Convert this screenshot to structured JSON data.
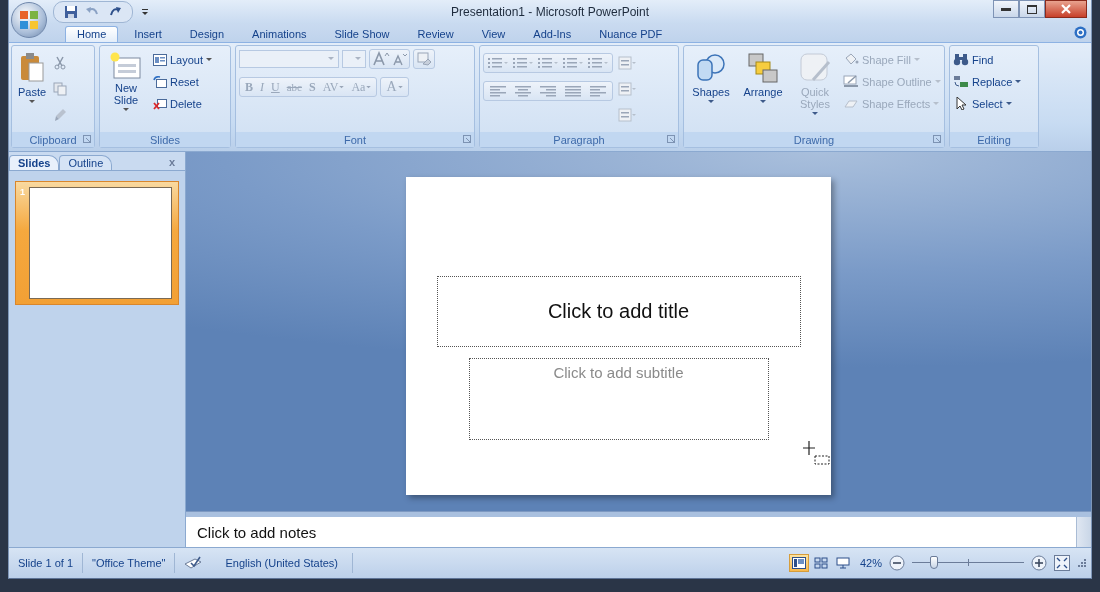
{
  "window": {
    "title": "Presentation1 - Microsoft PowerPoint"
  },
  "tabs": [
    {
      "label": "Home",
      "selected": true
    },
    {
      "label": "Insert",
      "selected": false
    },
    {
      "label": "Design",
      "selected": false
    },
    {
      "label": "Animations",
      "selected": false
    },
    {
      "label": "Slide Show",
      "selected": false
    },
    {
      "label": "Review",
      "selected": false
    },
    {
      "label": "View",
      "selected": false
    },
    {
      "label": "Add-Ins",
      "selected": false
    },
    {
      "label": "Nuance PDF",
      "selected": false
    }
  ],
  "ribbon": {
    "groups": [
      {
        "label": "Clipboard",
        "launcher": true,
        "items": [
          {
            "label": "Paste",
            "disabled": false,
            "menu": true
          }
        ]
      },
      {
        "label": "Slides",
        "launcher": false,
        "items": [
          {
            "label": "New Slide",
            "disabled": false,
            "menu": true
          },
          {
            "label": "Layout",
            "disabled": false,
            "menu": true
          },
          {
            "label": "Reset",
            "disabled": false,
            "menu": false
          },
          {
            "label": "Delete",
            "disabled": false,
            "menu": false
          }
        ]
      },
      {
        "label": "Font",
        "launcher": true,
        "items": [
          {
            "label": "B",
            "disabled": true,
            "menu": false
          },
          {
            "label": "I",
            "disabled": true,
            "menu": false
          },
          {
            "label": "U",
            "disabled": true,
            "menu": false
          },
          {
            "label": "abc",
            "disabled": true,
            "menu": false
          },
          {
            "label": "S",
            "disabled": true,
            "menu": false
          },
          {
            "label": "AV",
            "disabled": true,
            "menu": true
          },
          {
            "label": "Aa",
            "disabled": true,
            "menu": true
          },
          {
            "label": "A",
            "disabled": true,
            "menu": true
          }
        ]
      },
      {
        "label": "Paragraph",
        "launcher": true
      },
      {
        "label": "Drawing",
        "launcher": true,
        "items": [
          {
            "label": "Shapes",
            "disabled": false,
            "menu": true
          },
          {
            "label": "Arrange",
            "disabled": false,
            "menu": true
          },
          {
            "label": "Quick Styles",
            "disabled": true,
            "menu": true
          },
          {
            "label": "Shape Fill",
            "disabled": true,
            "menu": true
          },
          {
            "label": "Shape Outline",
            "disabled": true,
            "menu": true
          },
          {
            "label": "Shape Effects",
            "disabled": true,
            "menu": true
          }
        ]
      },
      {
        "label": "Editing",
        "launcher": false,
        "items": [
          {
            "label": "Find",
            "disabled": false,
            "menu": false
          },
          {
            "label": "Replace",
            "disabled": false,
            "menu": true
          },
          {
            "label": "Select",
            "disabled": false,
            "menu": true
          }
        ]
      }
    ]
  },
  "panel": {
    "tabs": [
      {
        "label": "Slides",
        "selected": true
      },
      {
        "label": "Outline",
        "selected": false
      }
    ],
    "close": "x",
    "thumbnails": [
      {
        "number": "1",
        "selected": true
      }
    ]
  },
  "slide": {
    "title_placeholder": "Click to add title",
    "subtitle_placeholder": "Click to add subtitle"
  },
  "notes": {
    "placeholder": "Click to add notes"
  },
  "status_bar": {
    "items": [
      "Slide 1 of 1",
      "\"Office Theme\"",
      "English (United States)"
    ],
    "views": [
      {
        "selected": true
      },
      {
        "selected": false
      },
      {
        "selected": false
      }
    ],
    "zoom": "42%",
    "zoom_slider": {
      "level": 0.2
    }
  }
}
